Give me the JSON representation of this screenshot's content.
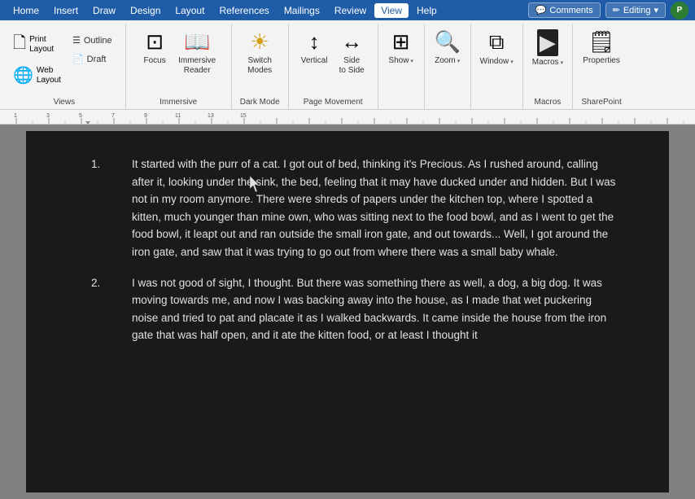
{
  "menubar": {
    "items": [
      "Home",
      "Insert",
      "Draw",
      "Design",
      "Layout",
      "References",
      "Mailings",
      "Review",
      "View",
      "Help"
    ],
    "active_item": "View",
    "comments_label": "Comments",
    "editing_label": "Editing",
    "editing_icon": "✏️",
    "pencil_icon": "✏"
  },
  "ribbon": {
    "groups": [
      {
        "name": "Views",
        "label": "Views",
        "buttons": [
          {
            "id": "print-layout",
            "icon": "🗋",
            "label": "Print\nLayout",
            "type": "tall"
          },
          {
            "id": "web-layout",
            "icon": "🌐",
            "label": "Web\nLayout",
            "type": "tall"
          }
        ],
        "small_buttons": [
          {
            "id": "outline",
            "label": "Outline"
          },
          {
            "id": "draft",
            "label": "Draft"
          }
        ]
      },
      {
        "name": "Immersive",
        "label": "Immersive",
        "buttons": [
          {
            "id": "focus",
            "icon": "⊡",
            "label": "Focus",
            "type": "tall"
          },
          {
            "id": "immersive-reader",
            "icon": "📖",
            "label": "Immersive\nReader",
            "type": "tall"
          }
        ]
      },
      {
        "name": "DarkMode",
        "label": "Dark Mode",
        "buttons": [
          {
            "id": "switch-modes",
            "icon": "☀",
            "label": "Switch\nModes",
            "type": "tall"
          }
        ]
      },
      {
        "name": "PageMovement",
        "label": "Page Movement",
        "buttons": [
          {
            "id": "vertical",
            "icon": "↕",
            "label": "Vertical",
            "type": "tall"
          },
          {
            "id": "side-to-side",
            "icon": "↔",
            "label": "Side\nto Side",
            "type": "tall"
          }
        ]
      },
      {
        "name": "Show",
        "label": "",
        "buttons": [
          {
            "id": "show",
            "icon": "⊞",
            "label": "Show",
            "type": "tall",
            "dropdown": true
          }
        ]
      },
      {
        "name": "Zoom",
        "label": "",
        "buttons": [
          {
            "id": "zoom",
            "icon": "🔍",
            "label": "Zoom",
            "type": "tall",
            "dropdown": true
          }
        ]
      },
      {
        "name": "Window",
        "label": "",
        "buttons": [
          {
            "id": "window",
            "icon": "⧉",
            "label": "Window",
            "type": "tall",
            "dropdown": true
          }
        ]
      },
      {
        "name": "Macros",
        "label": "Macros",
        "buttons": [
          {
            "id": "macros",
            "icon": "⬛",
            "label": "Macros",
            "type": "tall",
            "dropdown": true
          }
        ]
      },
      {
        "name": "SharePoint",
        "label": "SharePoint",
        "buttons": [
          {
            "id": "properties",
            "icon": "🗒",
            "label": "Properties",
            "type": "tall"
          }
        ]
      }
    ]
  },
  "ruler": {
    "visible": true
  },
  "document": {
    "background": "#1a1a1a",
    "text_color": "#e0e0e0",
    "paragraphs": [
      {
        "number": "1.",
        "text": "It started with the purr of a cat. I got out of bed, thinking it's Precious. As I rushed around, calling after it, looking under the sink, the bed, feeling that it may have ducked under and hidden. But I was not in my room anymore. There were shreds of papers under the kitchen top, where I spotted a kitten, much younger than mine own, who was sitting next to the food bowl, and as I went to get the food bowl, it leapt out and ran outside the small iron gate, and out towards... Well, I got around the iron gate, and saw that it was trying to go out from where there was a small baby whale."
      },
      {
        "number": "2.",
        "text": "I was not good of sight, I thought. But there was something there as well, a dog, a big dog. It was moving towards me, and now I was backing away into the house, as I made that wet puckering noise and tried to pat and placate it as I walked backwards. It came inside the house from the iron gate that was half open, and it ate the kitten food, or at least I thought it"
      }
    ]
  }
}
